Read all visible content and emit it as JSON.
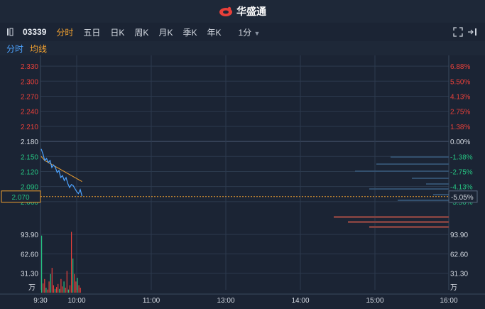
{
  "brand": {
    "name": "华盛通",
    "accent": "#e8403a"
  },
  "toolbar": {
    "symbol": "03339",
    "periods": [
      "分时",
      "五日",
      "日K",
      "周K",
      "月K",
      "季K",
      "年K"
    ],
    "active_period": "分时",
    "interval": "1分"
  },
  "legend": {
    "line1": "分时",
    "line2": "均线",
    "line1_color": "#4da3ff",
    "line2_color": "#f0a030"
  },
  "price_axis": {
    "upper_labels": [
      "2.330",
      "2.300",
      "2.270",
      "2.240",
      "2.210"
    ],
    "upper_pct": [
      "6.88%",
      "5.50%",
      "4.13%",
      "2.75%",
      "1.38%"
    ],
    "mid_label": "2.180",
    "mid_pct": "0.00%",
    "lower_labels": [
      "2.150",
      "2.120",
      "2.090",
      "2.060"
    ],
    "lower_pct": [
      "-1.38%",
      "-2.75%",
      "-4.13%",
      "-5.50%"
    ],
    "current_price": "2.070",
    "current_pct": "-5.05%"
  },
  "volume_axis": {
    "labels": [
      "93.90",
      "62.60",
      "31.30"
    ],
    "unit": "万"
  },
  "time_axis": [
    "9:30",
    "10:00",
    "11:00",
    "13:00",
    "14:00",
    "15:00",
    "16:00"
  ],
  "colors": {
    "up": "#e8403a",
    "down": "#26c281",
    "flat": "#d6dbe3"
  },
  "chart_data": {
    "type": "line",
    "title": "",
    "prev_close": 2.18,
    "current_price": 2.07,
    "series": [
      {
        "name": "分时",
        "values": [
          2.165,
          2.155,
          2.142,
          2.146,
          2.138,
          2.142,
          2.128,
          2.133,
          2.128,
          2.118,
          2.122,
          2.108,
          2.112,
          2.102,
          2.108,
          2.096,
          2.088,
          2.094,
          2.092,
          2.086,
          2.08,
          2.076,
          2.084,
          2.071
        ]
      },
      {
        "name": "均线",
        "values": [
          2.15,
          2.146,
          2.142,
          2.14,
          2.138,
          2.136,
          2.134,
          2.132,
          2.13,
          2.128,
          2.126,
          2.124,
          2.122,
          2.12,
          2.118,
          2.116,
          2.114,
          2.112,
          2.11,
          2.108,
          2.106,
          2.104,
          2.102,
          2.1
        ]
      }
    ],
    "volume": [
      92,
      15,
      22,
      8,
      5,
      18,
      30,
      40,
      12,
      6,
      9,
      14,
      6,
      22,
      10,
      18,
      8,
      35,
      5,
      12,
      98,
      55,
      30,
      18,
      24,
      12,
      8
    ],
    "ylim": [
      2.04,
      2.34
    ]
  }
}
